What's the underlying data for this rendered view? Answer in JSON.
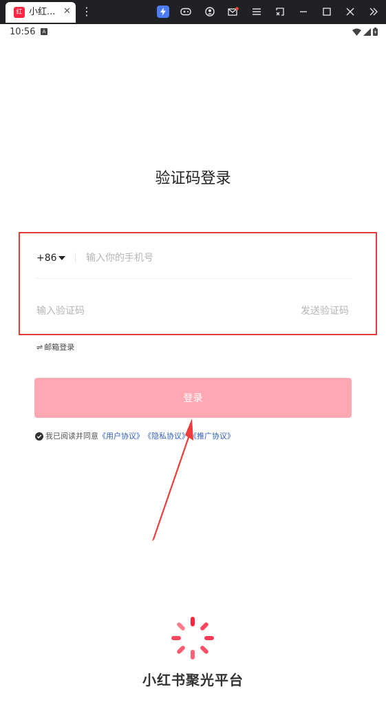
{
  "window": {
    "tab_title": "小红...",
    "tab_close": "✕",
    "favicon_glyph": "红",
    "toolbar_icons": [
      "bolt-icon",
      "gamepad-icon",
      "account-icon",
      "mail-icon",
      "menu-icon",
      "screenshot-icon",
      "minimize-icon",
      "maximize-icon",
      "close-icon",
      "more-icon"
    ]
  },
  "statusbar": {
    "time": "10:56",
    "badge": "A"
  },
  "page": {
    "title": "验证码登录"
  },
  "form": {
    "country_code": "+86",
    "phone_placeholder": "输入你的手机号",
    "code_placeholder": "输入验证码",
    "send_code_label": "发送验证码"
  },
  "email_login": {
    "icon": "⇌",
    "label": "邮箱登录"
  },
  "login_button": {
    "label": "登录"
  },
  "agreement": {
    "prefix": "我已阅读并同意",
    "user_agreement": "《用户协议》",
    "privacy_agreement": "《隐私协议》",
    "promotion_agreement": "《推广协议》"
  },
  "brand": {
    "name": "小红书聚光平台"
  },
  "colors": {
    "accent": "#ff2442",
    "login_button": "#ffa8b3",
    "link": "#2f5ec4",
    "highlight_box": "#e53935"
  }
}
